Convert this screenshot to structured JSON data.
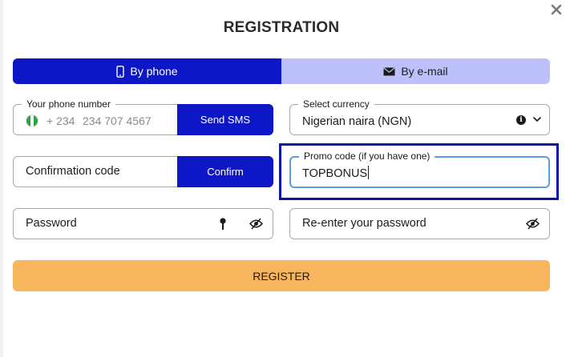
{
  "dialog": {
    "title": "REGISTRATION",
    "close_icon": "close-icon"
  },
  "tabs": [
    {
      "label": "By phone",
      "icon": "phone-icon",
      "active": true
    },
    {
      "label": "By e-mail",
      "icon": "envelope-icon",
      "active": false
    }
  ],
  "phone": {
    "label": "Your phone number",
    "country_flag": "nigeria-flag-icon",
    "prefix": "+ 234",
    "placeholder": "234 707 4567",
    "value": "",
    "send_sms_label": "Send SMS"
  },
  "currency": {
    "label": "Select currency",
    "value": "Nigerian naira (NGN)",
    "info_icon": "info-icon",
    "dropdown_icon": "chevron-down-icon"
  },
  "confirmation": {
    "placeholder": "Confirmation code",
    "confirm_label": "Confirm"
  },
  "promo": {
    "label": "Promo code (if you have one)",
    "value": "TOPBONUS"
  },
  "password": {
    "placeholder": "Password",
    "key_icon": "key-icon",
    "visibility_icon": "eye-off-icon"
  },
  "repassword": {
    "placeholder": "Re-enter your password",
    "visibility_icon": "eye-off-icon"
  },
  "register": {
    "label": "REGISTER"
  },
  "colors": {
    "primary": "#0d17c6",
    "tab_inactive": "#bcc0fb",
    "register": "#f7b55d",
    "highlight_frame": "#0a16a8",
    "focus_border": "#5a9ee6"
  }
}
